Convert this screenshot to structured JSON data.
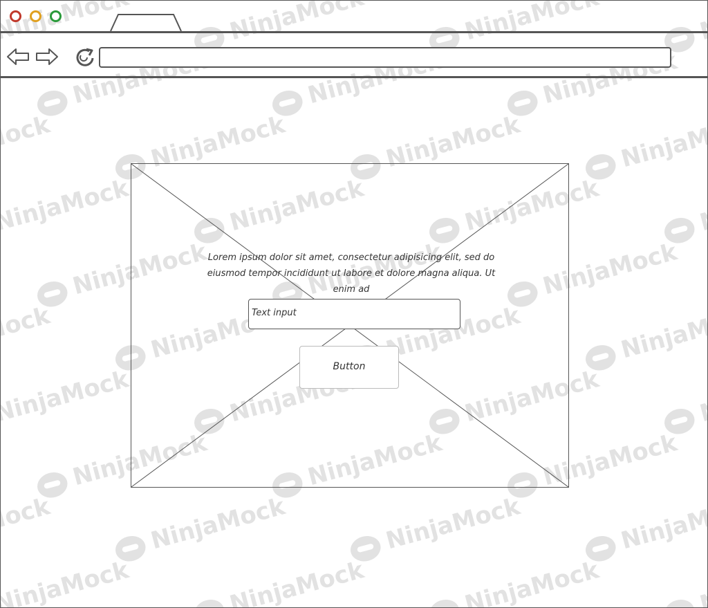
{
  "browser": {
    "window_controls": [
      "close-dot",
      "minimize-dot",
      "maximize-dot"
    ],
    "tab_label": "",
    "url": "",
    "icons": {
      "back": "arrow-left-icon",
      "forward": "arrow-right-icon",
      "reload": "reload-icon"
    }
  },
  "content": {
    "paragraph": "Lorem ipsum dolor sit amet, consectetur adipisicing elit, sed do eiusmod tempor incididunt ut labore et dolore magna aliqua. Ut enim ad",
    "text_input": {
      "value": "Text input"
    },
    "button": {
      "label": "Button"
    }
  },
  "watermark": {
    "text": "NinjaMock"
  },
  "colors": {
    "stroke": "#555555",
    "close": "#c0392b",
    "minimize": "#e0a020",
    "maximize": "#2a9a3a",
    "watermark": "#e2e2e2"
  }
}
